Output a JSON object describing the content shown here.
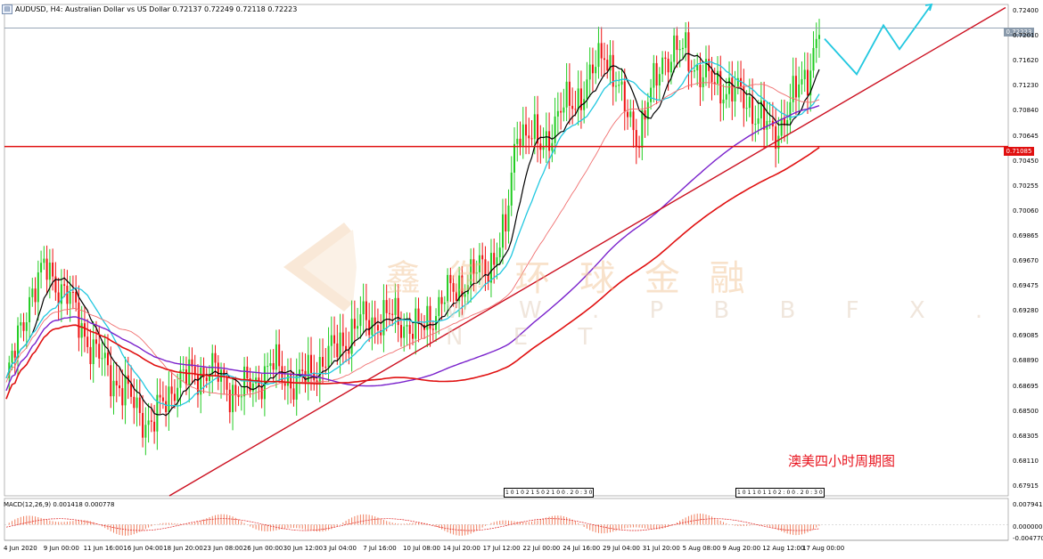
{
  "header": {
    "title": "AUDUSD, H4:  Australian Dollar vs US Dollar  0.72137 0.72249 0.72118 0.72223"
  },
  "annotation": "澳美四小时周期图",
  "watermark": {
    "cn": "鑫 御 环 球 金 融",
    "en": "W W . P B B F X . N E T"
  },
  "macd_label": "MACD(12,26,9) 0.001418 0.000778",
  "colors": {
    "bull": "#22cc22",
    "bear": "#ee1111",
    "ma_fast": "#000000",
    "ma_cyan": "#22c8e0",
    "ma_salmon": "#f07070",
    "ma_purple": "#7a22cc",
    "ma_red": "#e01010",
    "trendline": "#cc1020",
    "hline": "#e01010",
    "arrow": "#22c8e0"
  },
  "chart_data": {
    "type": "candlestick",
    "symbol": "AUDUSD",
    "timeframe": "H4",
    "ylim": [
      0.6773,
      0.7245
    ],
    "price_ticks": [
      "0.72400",
      "0.72010",
      "0.71620",
      "0.71230",
      "0.70840",
      "0.70645",
      "0.70450",
      "0.70255",
      "0.70060",
      "0.69865",
      "0.69670",
      "0.69475",
      "0.69280",
      "0.69085",
      "0.68890",
      "0.68695",
      "0.68500",
      "0.68305",
      "0.68110",
      "0.67915"
    ],
    "current_price": "0.72223",
    "hline_price": "0.71085",
    "hline_label": "0.71085",
    "time_labels": [
      "4 Jun 2020",
      "9 Jun 00:00",
      "11 Jun 16:00",
      "16 Jun 04:00",
      "18 Jun 20:00",
      "23 Jun 08:00",
      "26 Jun 00:00",
      "30 Jun 12:00",
      "3 Jul 04:00",
      "7 Jul 16:00",
      "10 Jul 08:00",
      "14 Jul 20:00",
      "17 Jul 12:00",
      "22 Jul 00:00",
      "24 Jul 16:00",
      "29 Jul 04:00",
      "31 Jul 20:00",
      "5 Aug 08:00",
      "9 Aug 20:00",
      "12 Aug 12:00",
      "17 Aug 00:00"
    ],
    "separator_labels": [
      "1 0 1 0 2 1 5 0 2 1 0 0 .  2 0 : 3 0",
      "1 0 1 1 0 1  1 0 2 : 0 0 . 2 0 : 3 0"
    ],
    "anchors": [
      [
        0,
        0.688
      ],
      [
        8,
        0.6965
      ],
      [
        14,
        0.6992
      ],
      [
        22,
        0.696
      ],
      [
        30,
        0.6912
      ],
      [
        40,
        0.6875
      ],
      [
        50,
        0.684
      ],
      [
        58,
        0.6882
      ],
      [
        70,
        0.6895
      ],
      [
        80,
        0.687
      ],
      [
        92,
        0.6898
      ],
      [
        100,
        0.688
      ],
      [
        112,
        0.691
      ],
      [
        122,
        0.694
      ],
      [
        134,
        0.6945
      ],
      [
        142,
        0.693
      ],
      [
        150,
        0.696
      ],
      [
        158,
        0.698
      ],
      [
        166,
        0.6995
      ],
      [
        172,
        0.7025
      ],
      [
        176,
        0.713
      ],
      [
        184,
        0.7108
      ],
      [
        192,
        0.7145
      ],
      [
        200,
        0.7165
      ],
      [
        206,
        0.7205
      ],
      [
        212,
        0.715
      ],
      [
        218,
        0.712
      ],
      [
        226,
        0.7195
      ],
      [
        234,
        0.72
      ],
      [
        240,
        0.7175
      ],
      [
        248,
        0.7165
      ],
      [
        256,
        0.715
      ],
      [
        264,
        0.7118
      ],
      [
        270,
        0.7148
      ],
      [
        276,
        0.718
      ],
      [
        280,
        0.7222
      ]
    ],
    "macd": {
      "label": "MACD(12,26,9) 0.001418 0.000778",
      "ticks": [
        "0.007941",
        "0.000000",
        "-0.004770"
      ],
      "ylim": [
        -0.00477,
        0.007941
      ]
    },
    "forecast_arrow": [
      [
        0.7212,
        0
      ],
      [
        0.7178,
        12
      ],
      [
        0.7225,
        22
      ],
      [
        0.7202,
        28
      ],
      [
        0.7245,
        40
      ]
    ]
  }
}
